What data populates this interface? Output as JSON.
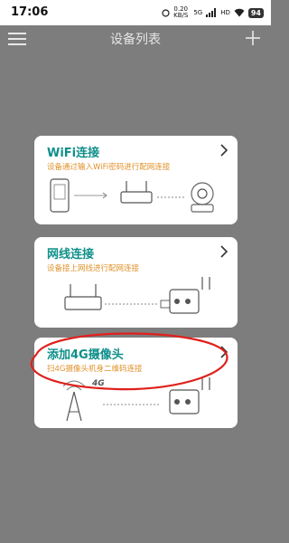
{
  "status_bar": {
    "time": "17:06",
    "speed_value": "0.20",
    "speed_unit": "KB/S",
    "network_1": "5G",
    "network_2": "HD",
    "battery": "94"
  },
  "header": {
    "title": "设备列表",
    "menu_icon": "menu-icon",
    "add_icon": "plus-icon"
  },
  "cards": [
    {
      "title": "WiFi连接",
      "subtitle": "设备通过输入WiFi密码进行配网连接",
      "icon": "chevron-right-icon"
    },
    {
      "title": "网线连接",
      "subtitle": "设备接上网线进行配网连接",
      "icon": "chevron-right-icon"
    },
    {
      "title": "添加4G摄像头",
      "subtitle": "扫4G摄像头机身二维码连接",
      "icon": "chevron-right-icon",
      "illustration_label": "4G"
    }
  ],
  "colors": {
    "title": "#0f8f8a",
    "subtitle": "#e0922b",
    "overlay": "#7d7d7d",
    "annotation": "#e0201c"
  }
}
